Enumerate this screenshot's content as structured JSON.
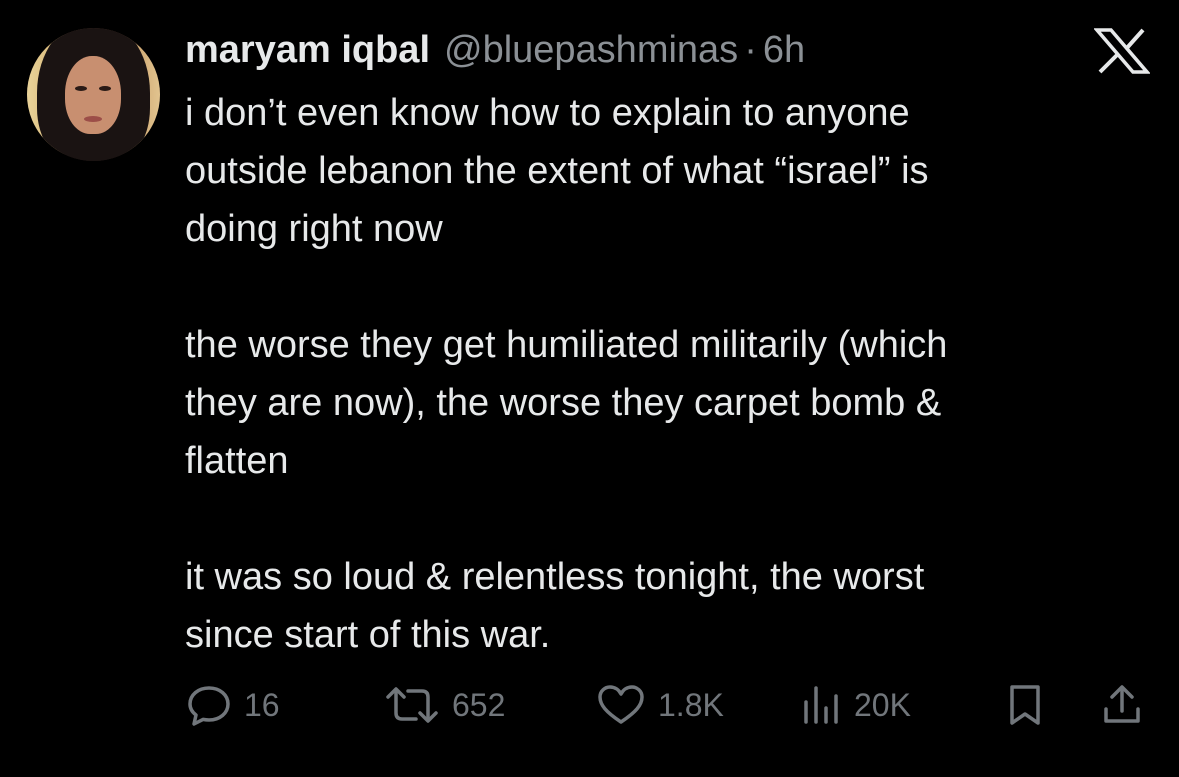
{
  "author": {
    "name": "maryam iqbal",
    "handle": "@bluepashminas",
    "separator": "·",
    "time": "6h"
  },
  "platform_icon": "x-logo-icon",
  "tweet": {
    "paragraphs": [
      "i don’t even know how to explain to anyone\noutside lebanon the extent of what “israel” is\ndoing right now",
      "the worse they get humiliated militarily (which\nthey are now), the worse they carpet bomb &\nflatten",
      "it was so loud & relentless tonight, the worst\nsince start of this war."
    ]
  },
  "actions": {
    "replies": "16",
    "reposts": "652",
    "likes": "1.8K",
    "views": "20K"
  },
  "colors": {
    "background": "#000000",
    "text": "#e7e9ea",
    "muted": "#71767b"
  }
}
